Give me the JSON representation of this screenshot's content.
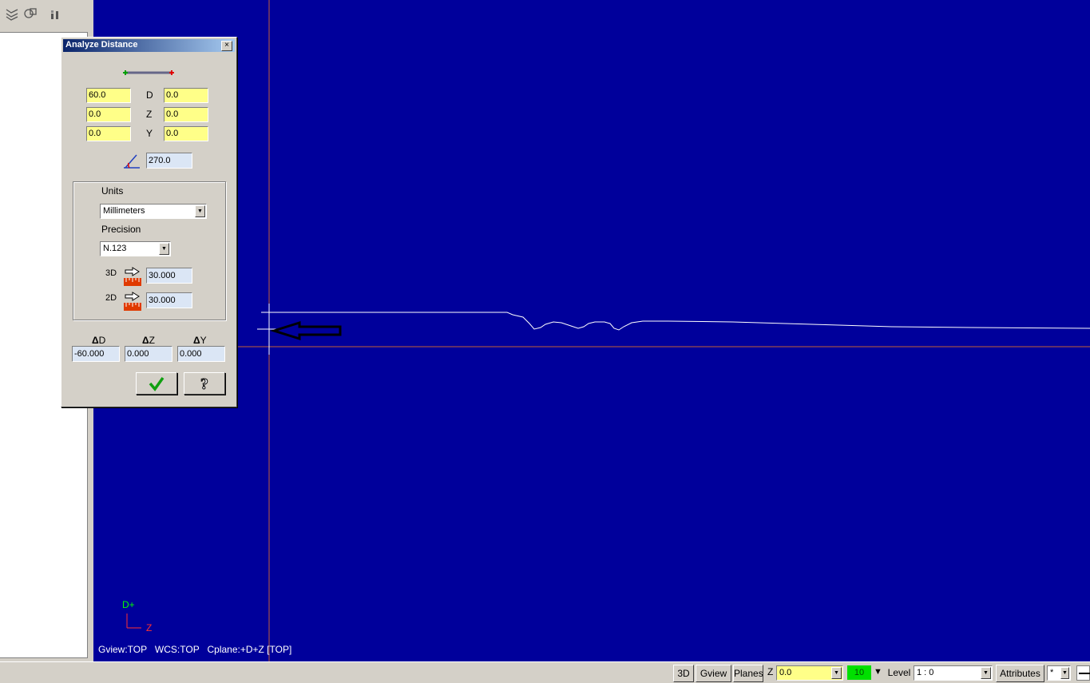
{
  "dialog": {
    "title": "Analyze Distance",
    "close_label": "×",
    "point1": {
      "x": "60.0",
      "y": "0.0",
      "z": "0.0"
    },
    "point2": {
      "x": "0.0",
      "y": "0.0",
      "z": "0.0"
    },
    "row_labels": [
      "D",
      "Z",
      "Y"
    ],
    "angle": "270.0",
    "units_label": "Units",
    "units_value": "Millimeters",
    "precision_label": "Precision",
    "precision_value": "N.123",
    "dist_3d_label": "3D",
    "dist_3d": "30.000",
    "dist_2d_label": "2D",
    "dist_2d": "30.000",
    "delta_labels": [
      "D",
      "Z",
      "Y"
    ],
    "delta_symbol": "Δ",
    "delta_d": "-60.000",
    "delta_z": "0.000",
    "delta_y": "0.000"
  },
  "viewport": {
    "axis_up": "D+",
    "axis_right": "Z",
    "status_text": "Gview:TOP   WCS:TOP   Cplane:+D+Z [TOP]",
    "background": "#00009b"
  },
  "statusbar": {
    "btn_3d": "3D",
    "btn_gview": "Gview",
    "btn_planes": "Planes",
    "z_label": "Z",
    "z_value": "0.0",
    "color_value": "10",
    "level_label": "Level",
    "level_value": "1 : 0",
    "attributes_label": "Attributes",
    "style_value": "*"
  },
  "icons": [
    "layers-icon",
    "shapes-icon",
    "chart-icon",
    "check-icon",
    "help-icon",
    "angle-icon",
    "ruler-icon"
  ]
}
